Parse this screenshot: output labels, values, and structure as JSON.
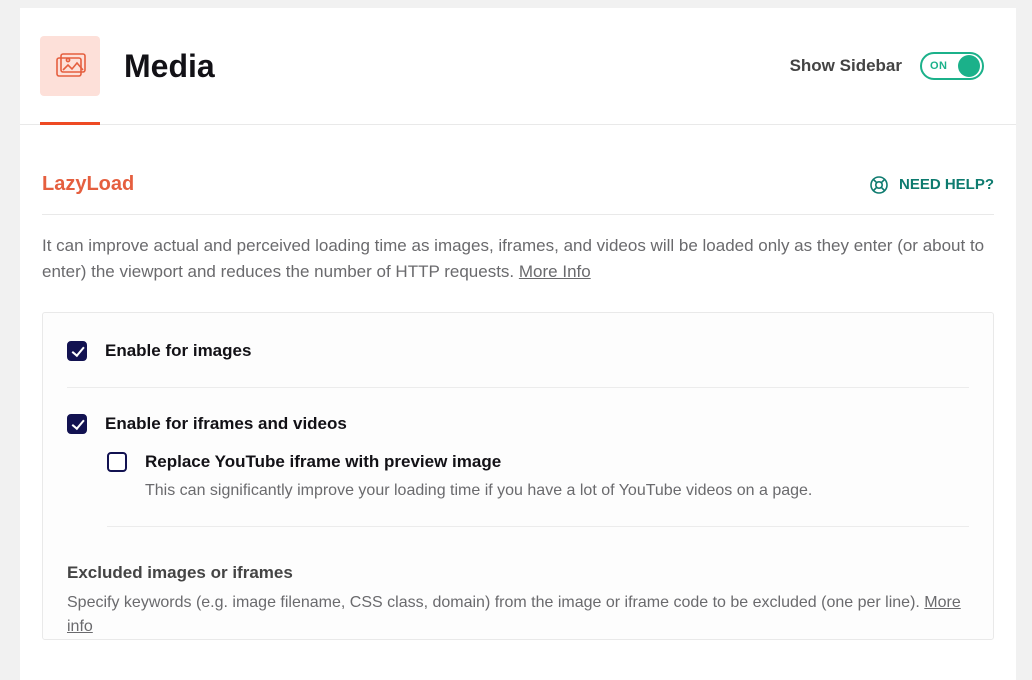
{
  "header": {
    "title": "Media",
    "show_sidebar_label": "Show Sidebar",
    "toggle_text": "ON"
  },
  "section": {
    "title": "LazyLoad",
    "help_label": "NEED HELP?",
    "description": "It can improve actual and perceived loading time as images, iframes, and videos will be loaded only as they enter (or about to enter) the viewport and reduces the number of HTTP requests.",
    "more_info": "More Info"
  },
  "options": {
    "images_label": "Enable for images",
    "iframes_label": "Enable for iframes and videos",
    "yt_label": "Replace YouTube iframe with preview image",
    "yt_help": "This can significantly improve your loading time if you have a lot of YouTube videos on a page."
  },
  "excluded": {
    "title": "Excluded images or iframes",
    "desc": "Specify keywords (e.g. image filename, CSS class, domain) from the image or iframe code to be excluded (one per line).",
    "more_info": "More info"
  }
}
